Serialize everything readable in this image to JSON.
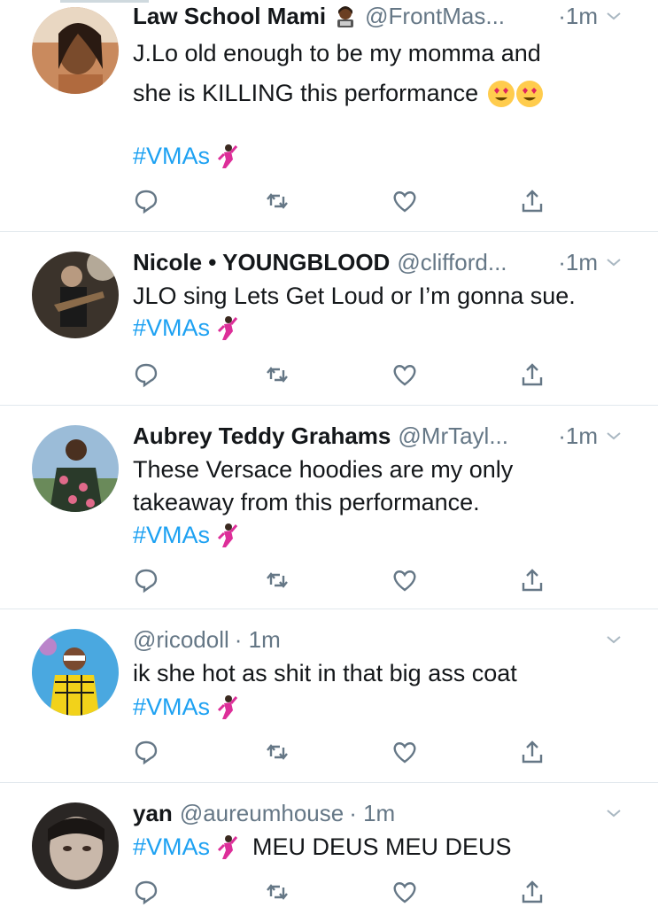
{
  "tweets": [
    {
      "name": "Law School Mami",
      "badge_emoji": "woman-technologist-icon",
      "handle": "@FrontMas...",
      "time": "·1m",
      "body_lines": [
        "J.Lo old enough to be my momma and",
        "she is KILLING this performance"
      ],
      "hashtag": "#VMAs",
      "trailing_text": ""
    },
    {
      "name": "Nicole • YOUNGBLOOD",
      "handle": "@clifford...",
      "time": "·1m",
      "body_lines": [
        "JLO sing Lets Get Loud or I’m gonna sue."
      ],
      "hashtag": "#VMAs",
      "trailing_text": ""
    },
    {
      "name": "Aubrey Teddy Grahams",
      "handle": "@MrTayl...",
      "time": "·1m",
      "body_lines": [
        "These Versace hoodies are my only",
        "takeaway from this performance."
      ],
      "hashtag": "#VMAs",
      "trailing_text": ""
    },
    {
      "name": "",
      "handle": "@ricodoll",
      "time": "· 1m",
      "body_lines": [
        "ik she hot as shit in that big ass coat"
      ],
      "hashtag": "#VMAs",
      "trailing_text": ""
    },
    {
      "name": "yan",
      "handle": "@aureumhouse",
      "time": "· 1m",
      "body_lines": [],
      "hashtag": "#VMAs",
      "trailing_text": "MEU DEUS MEU DEUS"
    }
  ],
  "icons": {
    "reply": "reply-icon",
    "retweet": "retweet-icon",
    "like": "heart-icon",
    "share": "share-icon",
    "caret": "chevron-down-icon",
    "heart_eyes": "heart-eyes-emoji",
    "dancer": "dancer-emoji"
  },
  "colors": {
    "hashtag": "#1da1f2",
    "secondary_text": "#657786",
    "action_icon": "#657786",
    "divider": "#e1e8ed"
  }
}
